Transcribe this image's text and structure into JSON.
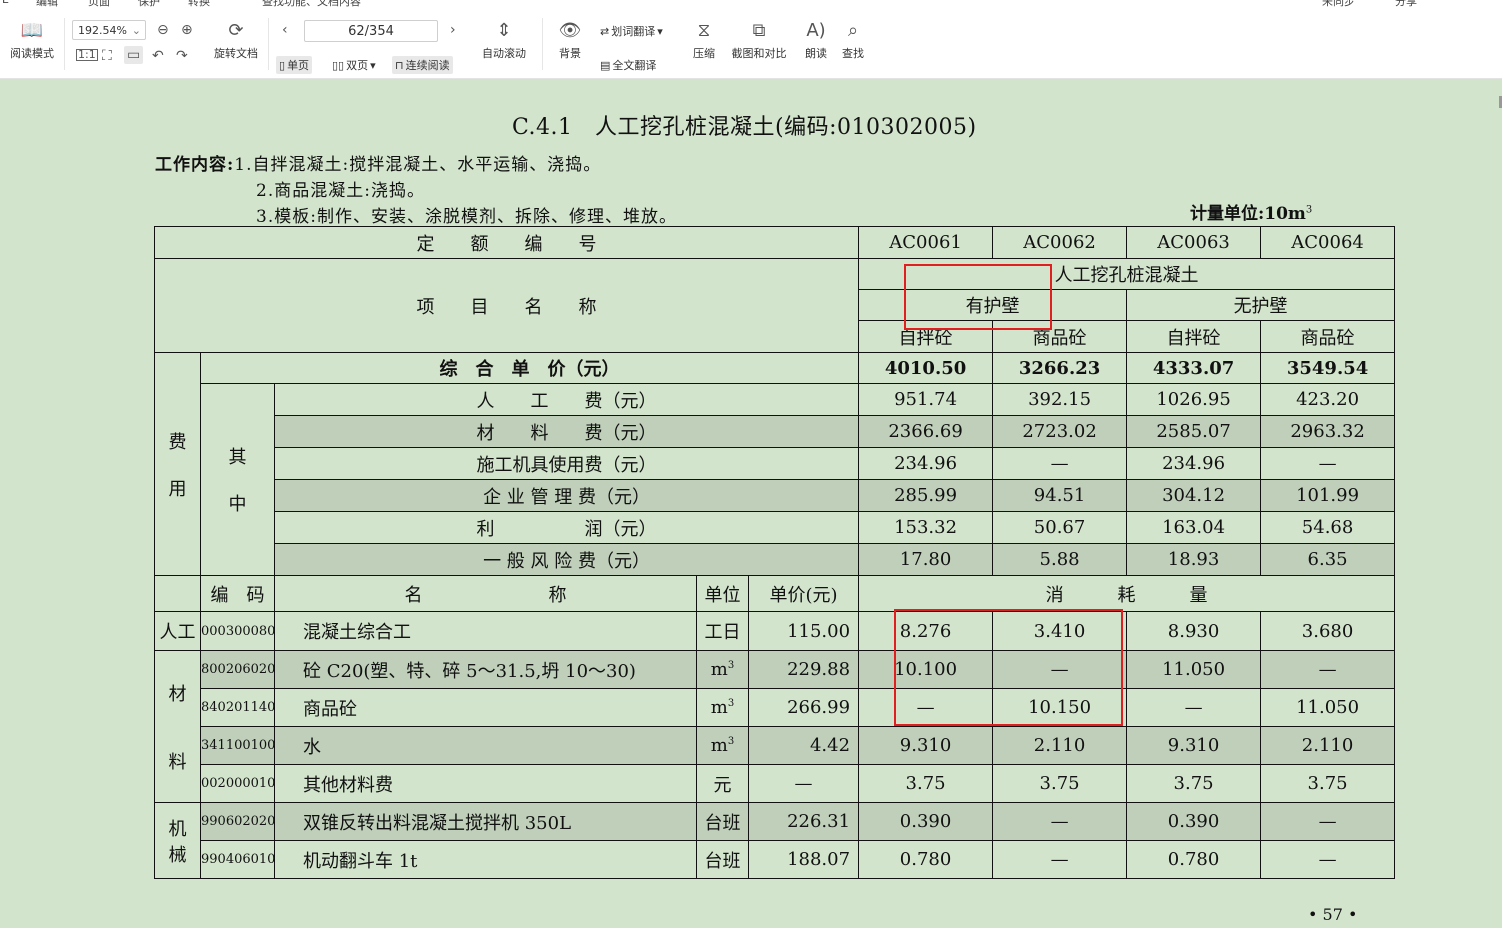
{
  "menu_strip": [
    "E",
    "编辑",
    "页面",
    "保护",
    "转换",
    "查找功能、文档内容",
    "未同步",
    "分享"
  ],
  "toolbar": {
    "reading_mode": "阅读模式",
    "zoom": "192.54%",
    "rotate": "旋转文档",
    "page_indicator": "62/354",
    "single_page": "单页",
    "double_page": "双页",
    "continuous": "连续阅读",
    "auto_scroll": "自动滚动",
    "background": "背景",
    "word_translate": "划词翻译",
    "full_translate": "全文翻译",
    "compress": "压缩",
    "screenshot_compare": "截图和对比",
    "read_aloud": "朗读",
    "search": "查找"
  },
  "document": {
    "title": "C.4.1　人工挖孔桩混凝土(编码:010302005)",
    "work_content_label": "工作内容:",
    "work_items": [
      "1.自拌混凝土:搅拌混凝土、水平运输、浇捣。",
      "2.商品混凝土:浇捣。",
      "3.模板:制作、安装、涂脱模剂、拆除、修理、堆放。"
    ],
    "unit_label": "计量单位:10m",
    "unit_sup": "3",
    "page_number": "• 57 •",
    "header": {
      "quota_no": "定　　额　　编　　号",
      "codes": [
        "AC0061",
        "AC0062",
        "AC0063",
        "AC0064"
      ],
      "item_name": "项　　目　　名　　称",
      "group": "人工挖孔桩混凝土",
      "with_wall": "有护壁",
      "without_wall": "无护壁",
      "sub": [
        "自拌砼",
        "商品砼",
        "自拌砼",
        "商品砼"
      ]
    },
    "cost": {
      "fee_label_1": "费",
      "fee_label_2": "用",
      "in_label_1": "其",
      "in_label_2": "中",
      "total_label": "综　合　单　价（元）",
      "total_values": [
        "4010.50",
        "3266.23",
        "4333.07",
        "3549.54"
      ],
      "rows": [
        {
          "label": "人　　工　　费（元）",
          "values": [
            "951.74",
            "392.15",
            "1026.95",
            "423.20"
          ]
        },
        {
          "label": "材　　料　　费（元）",
          "values": [
            "2366.69",
            "2723.02",
            "2585.07",
            "2963.32"
          ]
        },
        {
          "label": "施工机具使用费（元）",
          "values": [
            "234.96",
            "—",
            "234.96",
            "—"
          ]
        },
        {
          "label": "企 业 管 理 费（元）",
          "values": [
            "285.99",
            "94.51",
            "304.12",
            "101.99"
          ]
        },
        {
          "label": "利　　　　　润（元）",
          "values": [
            "153.32",
            "50.67",
            "163.04",
            "54.68"
          ]
        },
        {
          "label": "一 般 风 险 费（元）",
          "values": [
            "17.80",
            "5.88",
            "18.93",
            "6.35"
          ]
        }
      ]
    },
    "detail_header": {
      "code": "编　码",
      "name": "名　　　　　　　称",
      "unit": "单位",
      "price": "单价(元)",
      "consumption": "消　　　耗　　　量"
    },
    "groups": {
      "labor": "人工",
      "material_1": "材",
      "material_2": "料",
      "machine_1": "机",
      "machine_2": "械"
    },
    "details": [
      {
        "code": "000300080",
        "name": "混凝土综合工",
        "unit": "工日",
        "price": "115.00",
        "values": [
          "8.276",
          "3.410",
          "8.930",
          "3.680"
        ]
      },
      {
        "code": "800206020",
        "name": "砼 C20(塑、特、碎 5～31.5,坍 10～30)",
        "unit": "m",
        "unit_sup": "3",
        "price": "229.88",
        "values": [
          "10.100",
          "—",
          "11.050",
          "—"
        ]
      },
      {
        "code": "840201140",
        "name": "商品砼",
        "unit": "m",
        "unit_sup": "3",
        "price": "266.99",
        "values": [
          "—",
          "10.150",
          "—",
          "11.050"
        ]
      },
      {
        "code": "341100100",
        "name": "水",
        "unit": "m",
        "unit_sup": "3",
        "price": "4.42",
        "values": [
          "9.310",
          "2.110",
          "9.310",
          "2.110"
        ]
      },
      {
        "code": "002000010",
        "name": "其他材料费",
        "unit": "元",
        "price": "—",
        "values": [
          "3.75",
          "3.75",
          "3.75",
          "3.75"
        ]
      },
      {
        "code": "990602020",
        "name": "双锥反转出料混凝土搅拌机 350L",
        "unit": "台班",
        "price": "226.31",
        "values": [
          "0.390",
          "—",
          "0.390",
          "—"
        ]
      },
      {
        "code": "990406010",
        "name": "机动翻斗车 1t",
        "unit": "台班",
        "price": "188.07",
        "values": [
          "0.780",
          "—",
          "0.780",
          "—"
        ]
      }
    ]
  },
  "colors": {
    "page_bg": "#d3e4cd",
    "row_shade": "#bfcfba",
    "highlight": "#e02020"
  }
}
